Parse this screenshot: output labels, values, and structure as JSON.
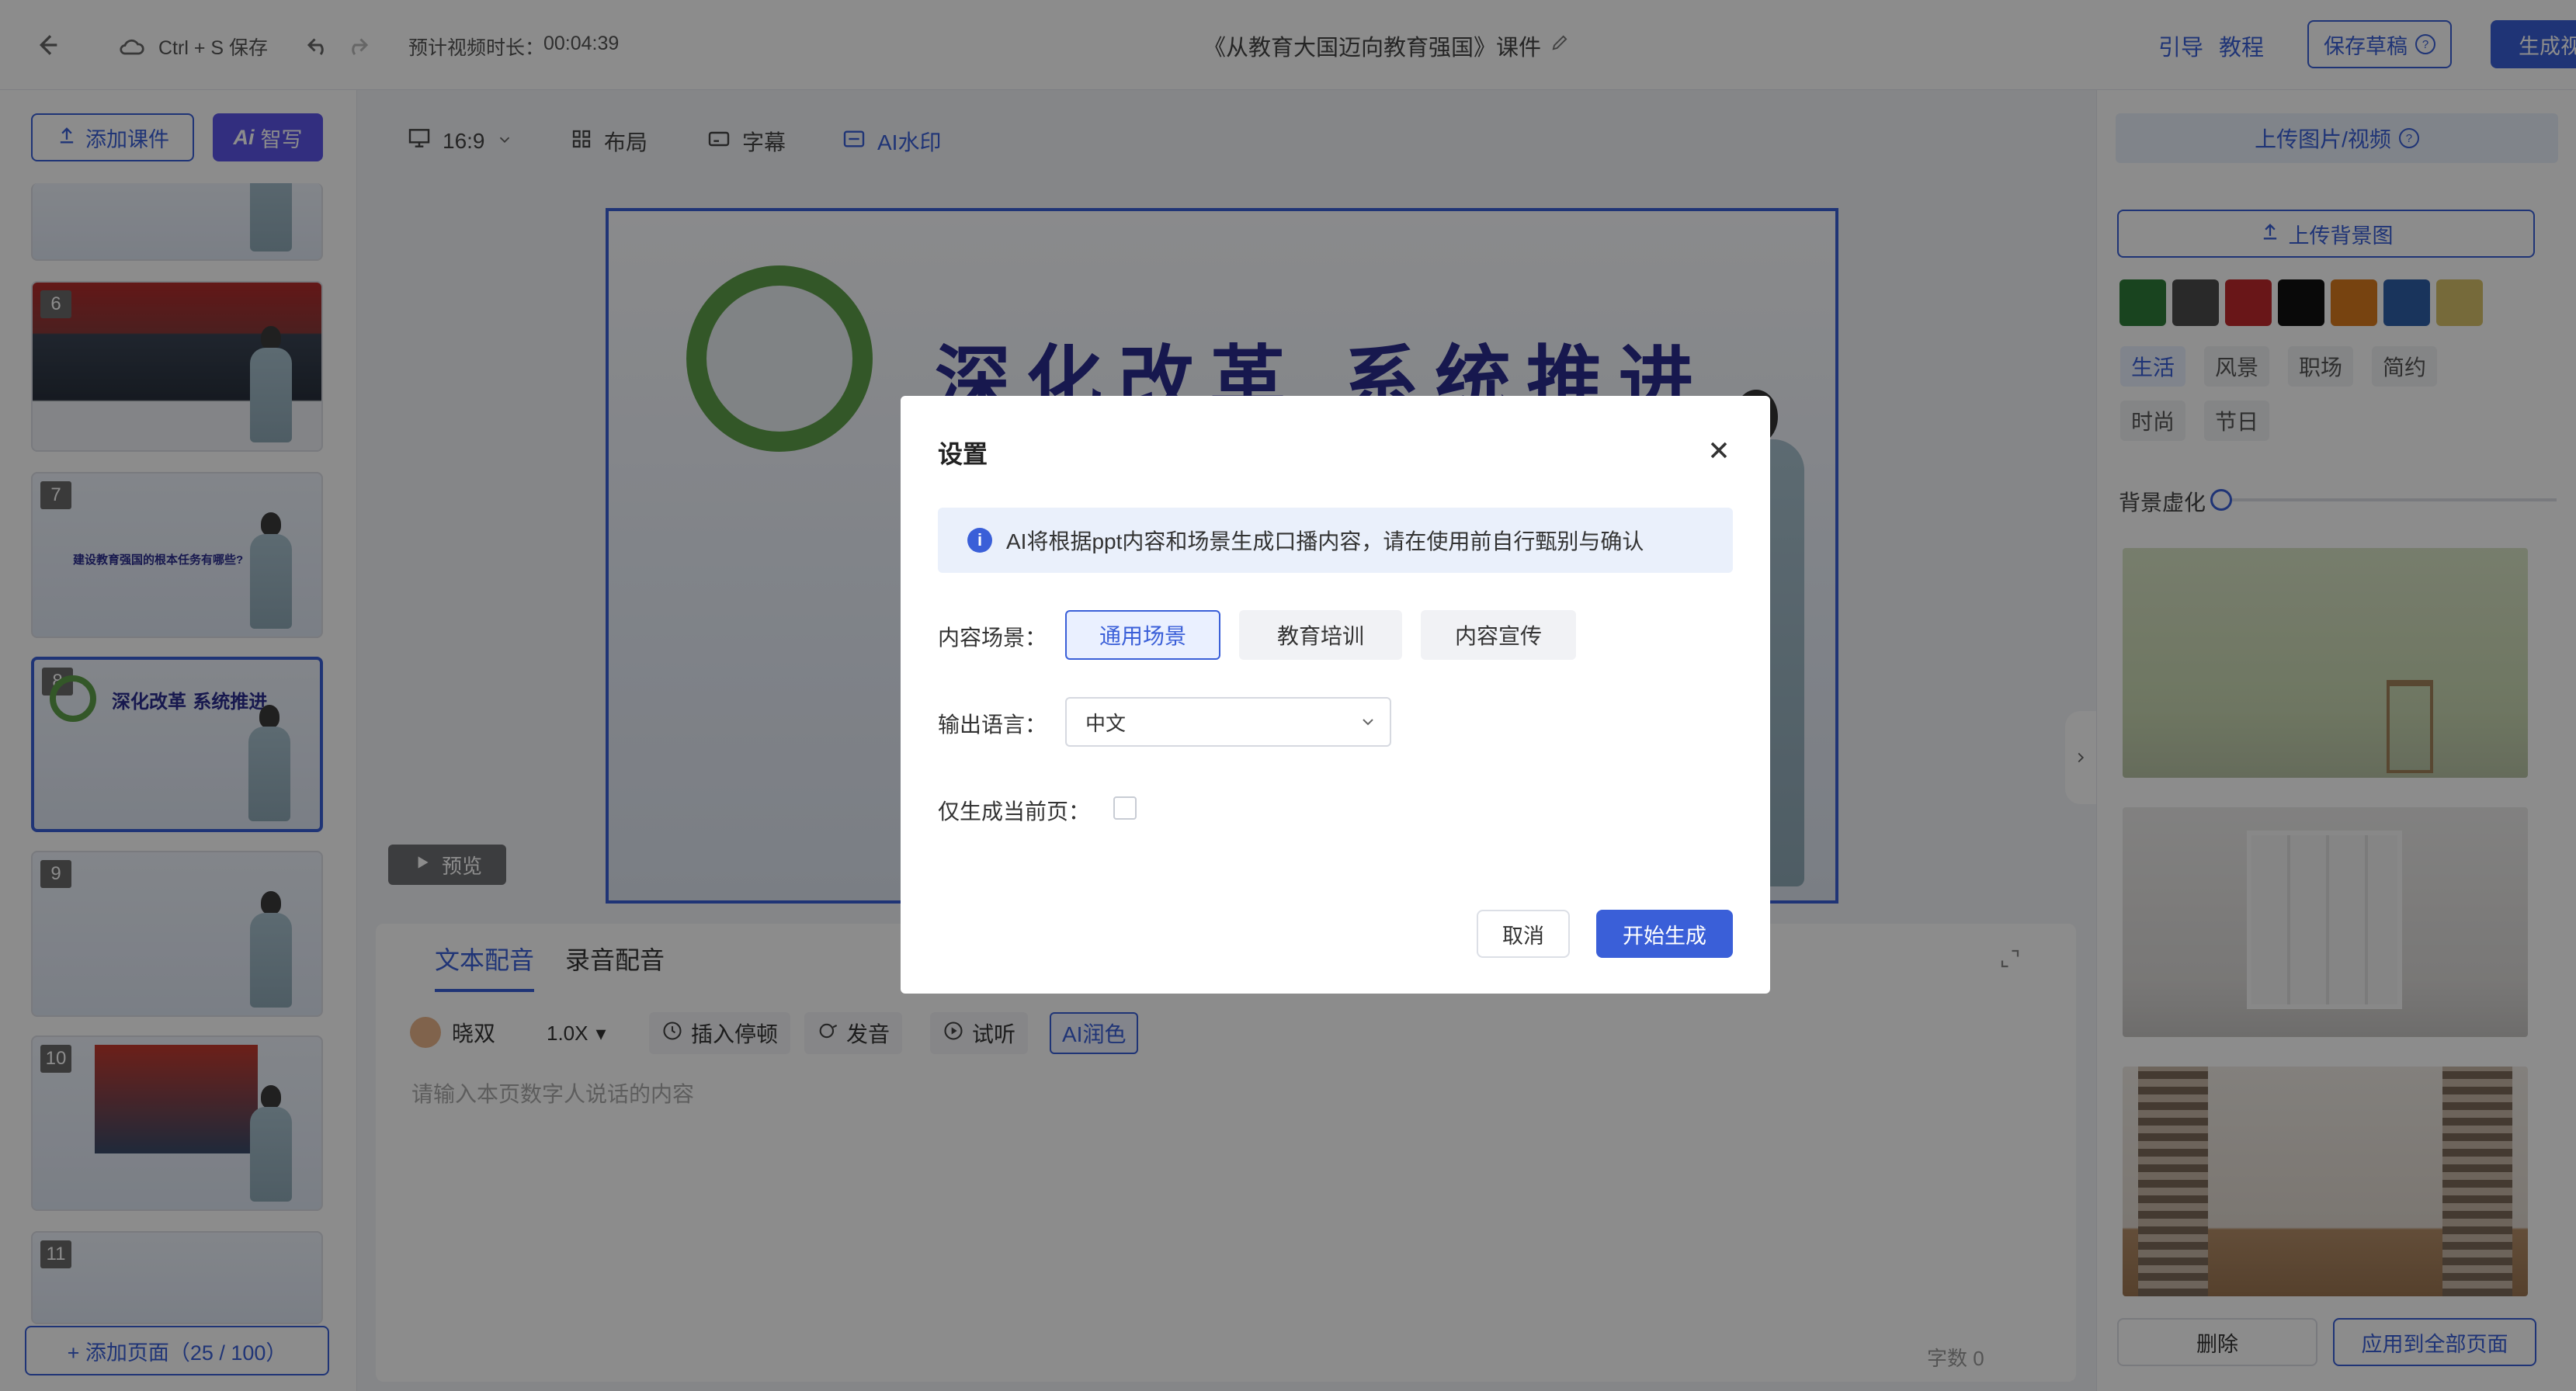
{
  "topbar": {
    "save_hint": "Ctrl + S 保存",
    "duration_label": "预计视频时长：",
    "duration_value": "00:04:39",
    "doc_title": "《从教育大国迈向教育强国》课件",
    "guide": "引导",
    "tutorial": "教程",
    "save_draft": "保存草稿",
    "generate": "生成视"
  },
  "left": {
    "add_courseware": "添加课件",
    "ai_write": "智写",
    "ai_badge": "Ai",
    "thumbs": [
      {
        "num": ""
      },
      {
        "num": "6"
      },
      {
        "num": "7"
      },
      {
        "num": "8"
      },
      {
        "num": "9"
      },
      {
        "num": "10"
      },
      {
        "num": "11"
      }
    ],
    "thumb7_text": "建设教育强国的根本任务有哪些?",
    "thumb8_title": "深化改革 系统推进",
    "add_page": "+ 添加页面（25 / 100）"
  },
  "toolbar": {
    "ratio": "16:9",
    "layout": "布局",
    "subtitle": "字幕",
    "watermark": "AI水印"
  },
  "slide": {
    "title": "深化改革 系统推进"
  },
  "preview": "预览",
  "editor": {
    "tab_text": "文本配音",
    "tab_record": "录音配音",
    "voice": "晓双",
    "speed": "1.0X",
    "insert_pause": "插入停顿",
    "pronounce": "发音",
    "listen": "试听",
    "ai_polish": "AI润色",
    "placeholder": "请输入本页数字人说话的内容",
    "word_count": "字数 0"
  },
  "right": {
    "upload_media": "上传图片/视频",
    "upload_bg": "上传背景图",
    "swatches": [
      "#2e7d3a",
      "#4b4b4b",
      "#c0282d",
      "#111111",
      "#d97a1e",
      "#2f5fa8",
      "#d8c26a"
    ],
    "cats_row1": [
      "生活",
      "风景",
      "职场",
      "简约"
    ],
    "cats_row2": [
      "时尚",
      "节日"
    ],
    "blur_label": "背景虚化",
    "delete": "删除",
    "apply_all": "应用到全部页面"
  },
  "modal": {
    "title": "设置",
    "info": "AI将根据ppt内容和场景生成口播内容，请在使用前自行甄别与确认",
    "scene_label": "内容场景：",
    "scenes": [
      "通用场景",
      "教育培训",
      "内容宣传"
    ],
    "lang_label": "输出语言：",
    "lang_value": "中文",
    "current_only_label": "仅生成当前页：",
    "cancel": "取消",
    "start": "开始生成"
  }
}
